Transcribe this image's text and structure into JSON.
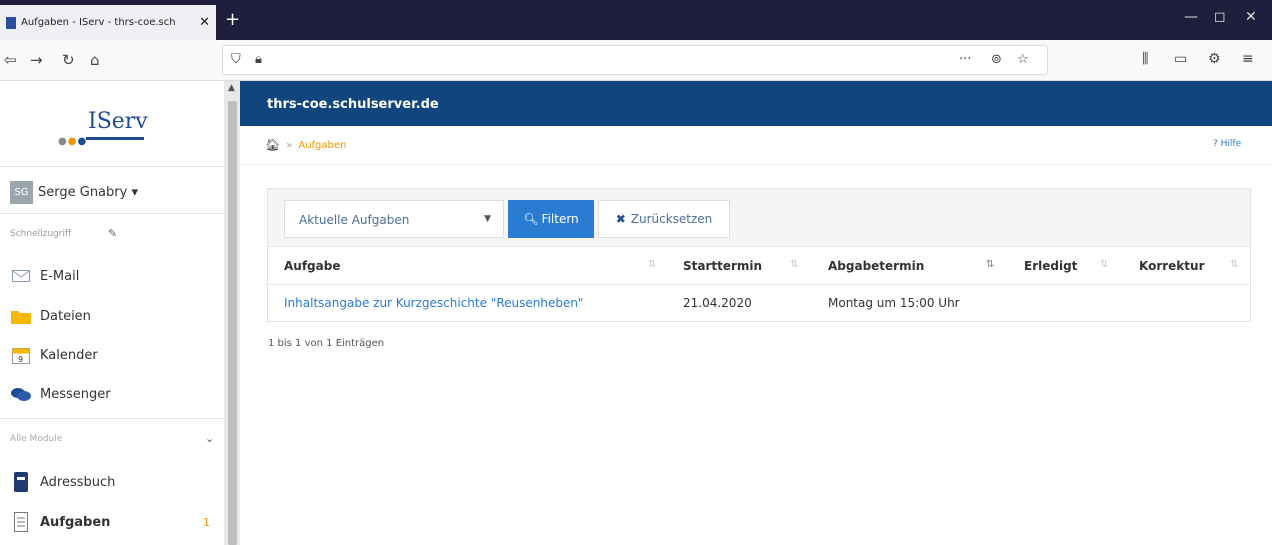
{
  "browser": {
    "tab_title": "Aufgaben - IServ - thrs-coe.sch",
    "tab_close": "✕",
    "new_tab": "+",
    "win_minimize": "—",
    "win_maximize": "◻",
    "win_close": "✕"
  },
  "sidebar": {
    "logo": "IServ",
    "user_initials": "SG",
    "user_name": "Serge Gnabry ▾",
    "quick_access": "Schnellzugriff",
    "quick_items": [
      {
        "label": "E-Mail",
        "icon": "mail-icon"
      },
      {
        "label": "Dateien",
        "icon": "folder-icon"
      },
      {
        "label": "Kalender",
        "icon": "calendar-icon"
      },
      {
        "label": "Messenger",
        "icon": "chat-icon"
      }
    ],
    "all_modules": "Alle Module",
    "module_items": [
      {
        "label": "Adressbuch",
        "icon": "addressbook-icon"
      },
      {
        "label": "Aufgaben",
        "icon": "tasks-icon",
        "badge": "1"
      }
    ]
  },
  "header": {
    "title": "thrs-coe.schulserver.de"
  },
  "breadcrumb": {
    "sep": "»",
    "current": "Aufgaben"
  },
  "help": "Hilfe",
  "filter": {
    "select_value": "Aktuelle Aufgaben",
    "filter_button": "Filtern",
    "reset_button": "Zurücksetzen"
  },
  "table": {
    "columns": [
      "Aufgabe",
      "Starttermin",
      "Abgabetermin",
      "Erledigt",
      "Korrektur"
    ],
    "rows": [
      [
        "Inhaltsangabe zur Kurzgeschichte \"Reusenheben\"",
        "21.04.2020",
        "Montag um 15:00 Uhr",
        "",
        ""
      ]
    ]
  },
  "info": "1 bis 1 von 1 Einträgen",
  "colors": {
    "header_bg": "#10457d",
    "accent": "#2a7bd2",
    "badge": "#f29400"
  }
}
